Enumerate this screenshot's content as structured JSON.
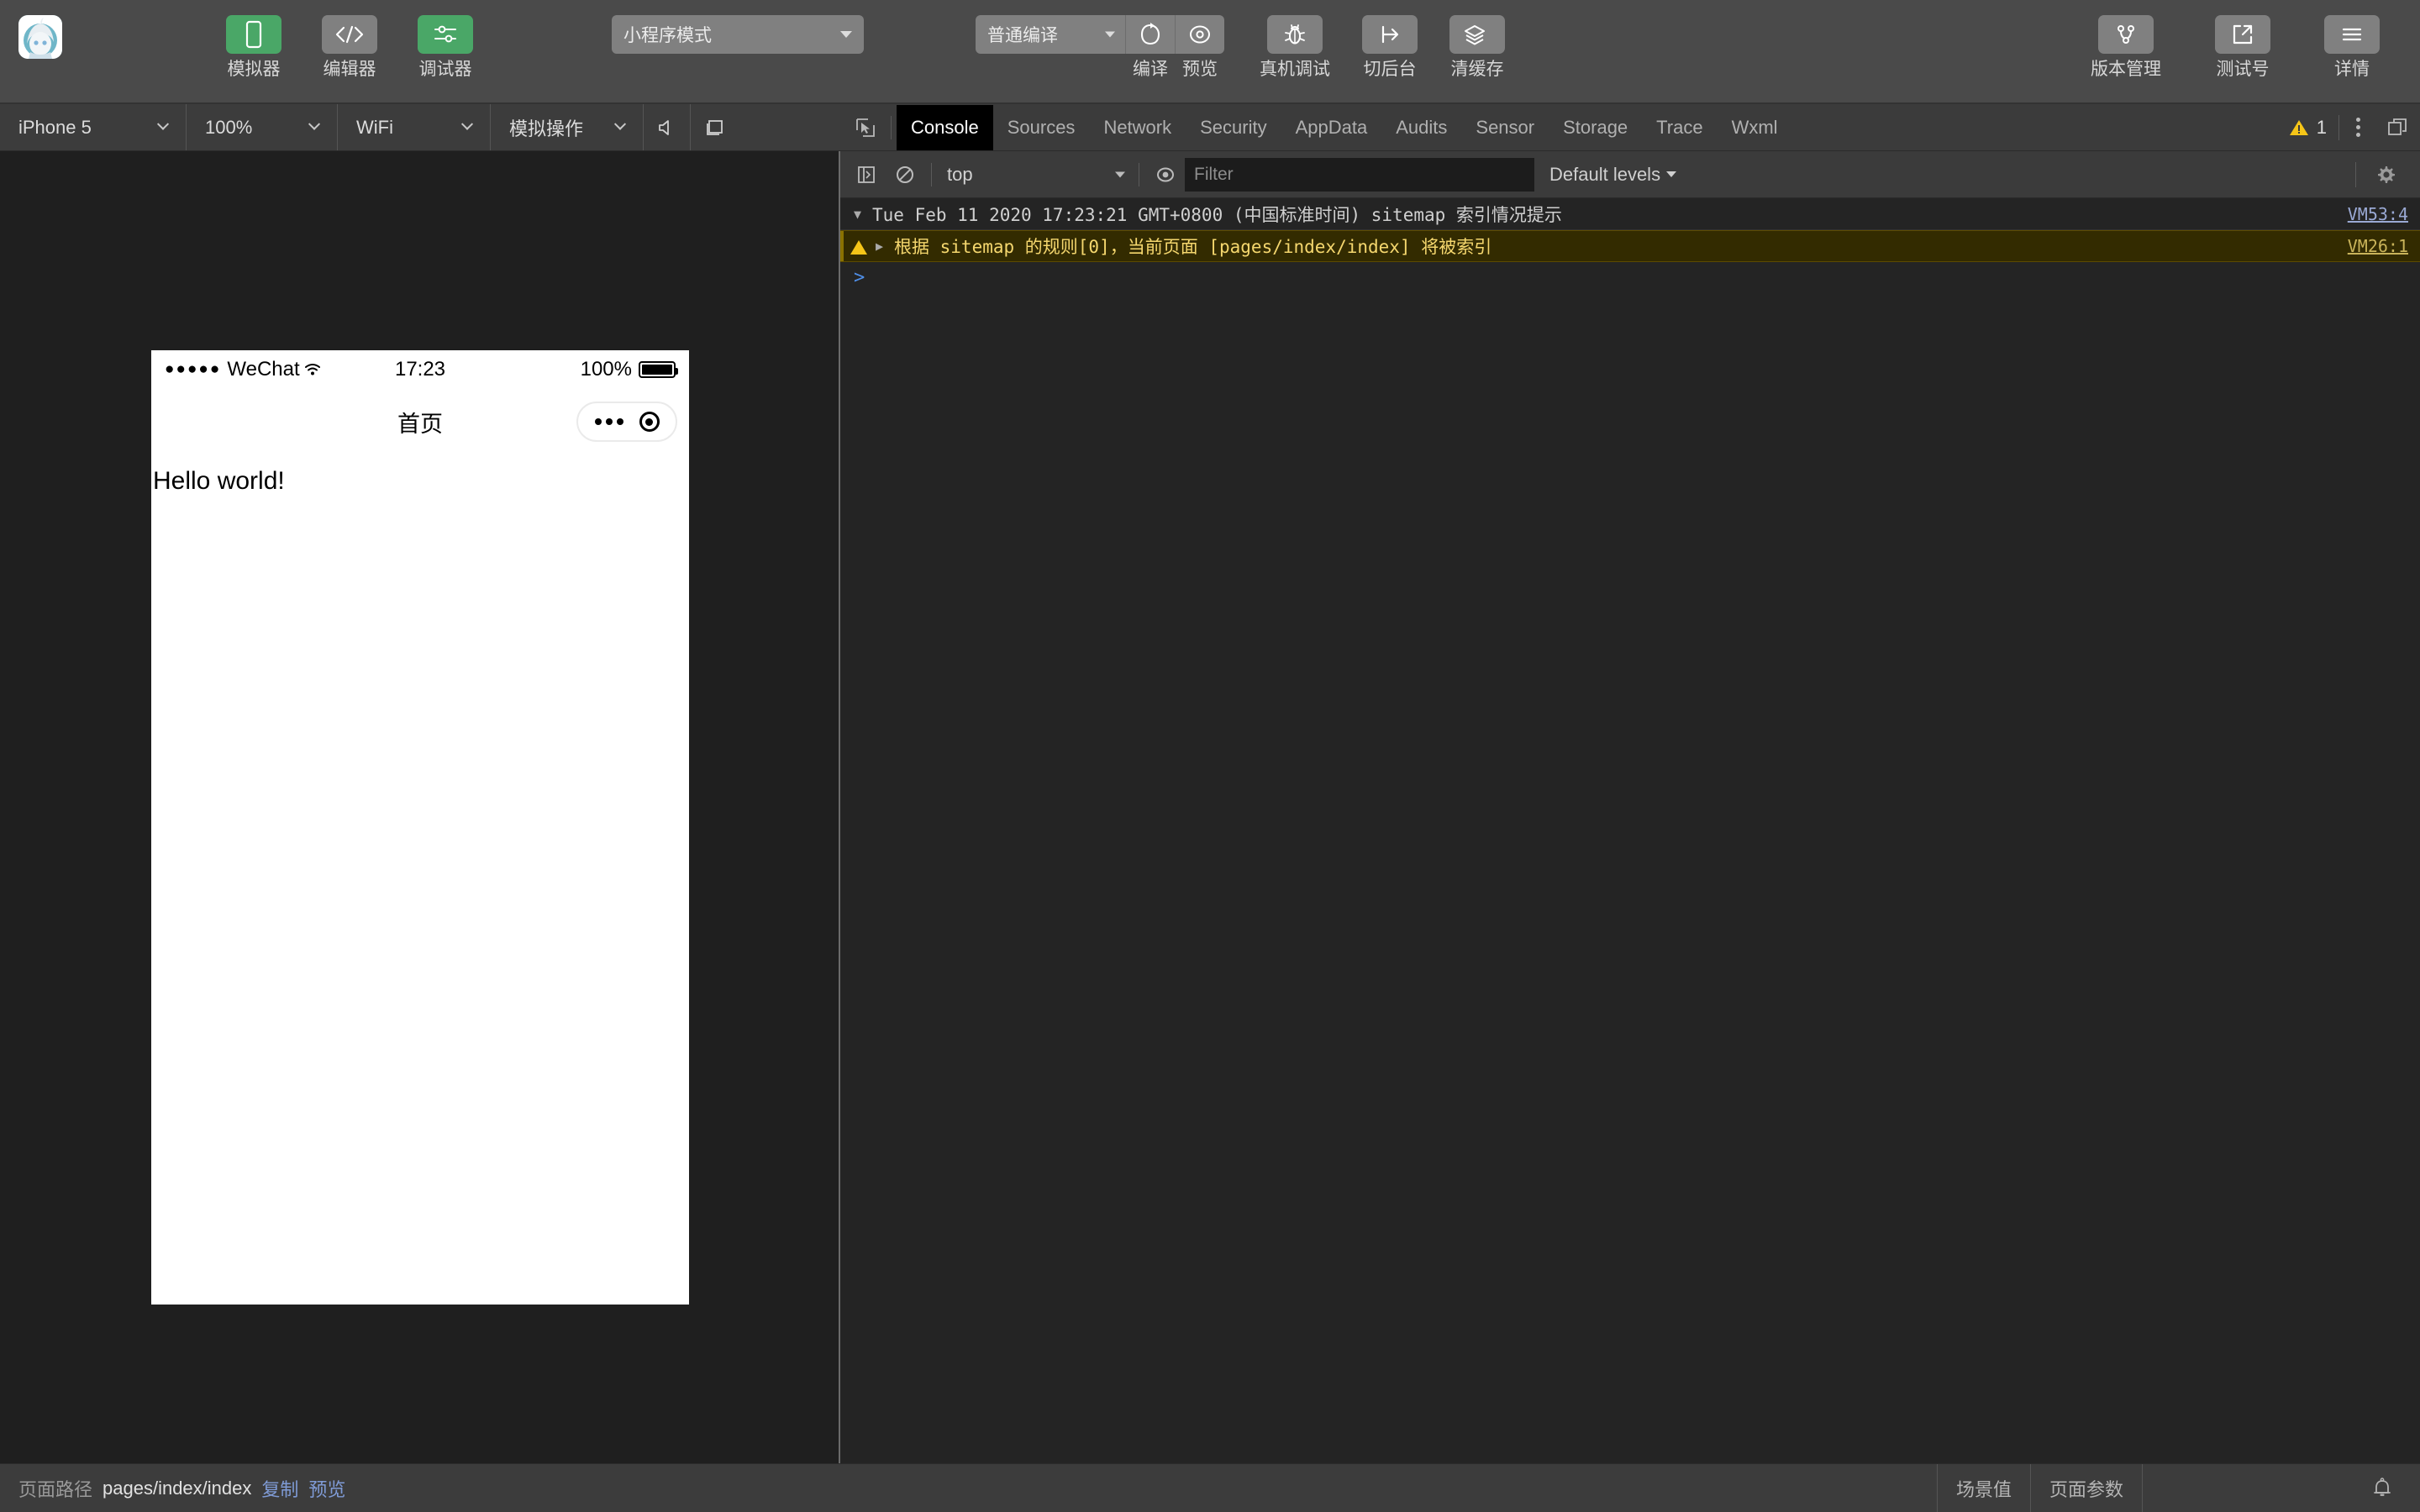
{
  "topbar": {
    "avatar_alt": "user-avatar",
    "left_buttons": [
      {
        "label": "模拟器",
        "icon": "phone-icon",
        "active": true
      },
      {
        "label": "编辑器",
        "icon": "code-icon",
        "active": false
      },
      {
        "label": "调试器",
        "icon": "debugger-icon",
        "active": true
      }
    ],
    "mode_select": {
      "value": "小程序模式"
    },
    "compile_select": {
      "value": "普通编译"
    },
    "actions": [
      {
        "label": "编译",
        "icon": "refresh-icon"
      },
      {
        "label": "预览",
        "icon": "preview-eye-icon"
      },
      {
        "label": "真机调试",
        "icon": "bug-icon"
      },
      {
        "label": "切后台",
        "icon": "background-icon"
      },
      {
        "label": "清缓存",
        "icon": "layers-icon"
      }
    ],
    "right_buttons": [
      {
        "label": "版本管理",
        "icon": "git-branch-icon"
      },
      {
        "label": "测试号",
        "icon": "external-link-icon"
      },
      {
        "label": "详情",
        "icon": "hamburger-icon"
      }
    ]
  },
  "simulator_toolbar": {
    "device": "iPhone 5",
    "zoom": "100%",
    "network": "WiFi",
    "operation": "模拟操作",
    "icons": [
      "volume-icon",
      "rotate-screen-icon"
    ]
  },
  "devtools": {
    "inspect_icon": "inspect-element-icon",
    "tabs": [
      {
        "label": "Console",
        "active": true
      },
      {
        "label": "Sources",
        "active": false
      },
      {
        "label": "Network",
        "active": false
      },
      {
        "label": "Security",
        "active": false
      },
      {
        "label": "AppData",
        "active": false
      },
      {
        "label": "Audits",
        "active": false
      },
      {
        "label": "Sensor",
        "active": false
      },
      {
        "label": "Storage",
        "active": false
      },
      {
        "label": "Trace",
        "active": false
      },
      {
        "label": "Wxml",
        "active": false
      }
    ],
    "warning_count": "1",
    "warning_icon": "warning-triangle-icon",
    "more_icon": "kebab-menu-icon",
    "dock_icon": "dock-panel-icon"
  },
  "console": {
    "toolbar": {
      "sidebar_icon": "console-sidebar-icon",
      "clear_icon": "clear-console-icon",
      "context": "top",
      "eye_icon": "live-expression-icon",
      "filter_placeholder": "Filter",
      "filter_value": "",
      "levels": "Default levels",
      "settings_icon": "gear-icon"
    },
    "messages": [
      {
        "type": "group",
        "disclosure": "▼",
        "text": "Tue Feb 11 2020 17:23:21 GMT+0800 (中国标准时间) sitemap 索引情况提示",
        "source": "VM53:4"
      },
      {
        "type": "warning",
        "disclosure": "▶",
        "text": "根据 sitemap 的规则[0]，当前页面 [pages/index/index] 将被索引",
        "source": "VM26:1"
      }
    ],
    "prompt": ">"
  },
  "simulator": {
    "status_bar": {
      "signal_dots": "●●●●●",
      "carrier": "WeChat",
      "wifi_icon": "wifi-icon",
      "time": "17:23",
      "battery_percent": "100%",
      "battery_icon": "battery-full-icon"
    },
    "nav_title": "首页",
    "capsule": {
      "menu_icon": "more-dots-icon",
      "close_icon": "target-circle-icon"
    },
    "page_content": "Hello world!"
  },
  "statusbar": {
    "path_label": "页面路径",
    "path_value": "pages/index/index",
    "copy_link": "复制",
    "preview_link": "预览",
    "scene_value": "场景值",
    "page_params": "页面参数",
    "bell_icon": "notification-bell-icon"
  },
  "colors": {
    "accent_green": "#4aa767",
    "toolbar_bg": "#4a4a4a",
    "panel_bg": "#3c3c3c",
    "console_bg": "#242424",
    "warning_bg": "#332b00",
    "warning_text": "#f5d76e",
    "link_blue": "#7f9bd6"
  }
}
